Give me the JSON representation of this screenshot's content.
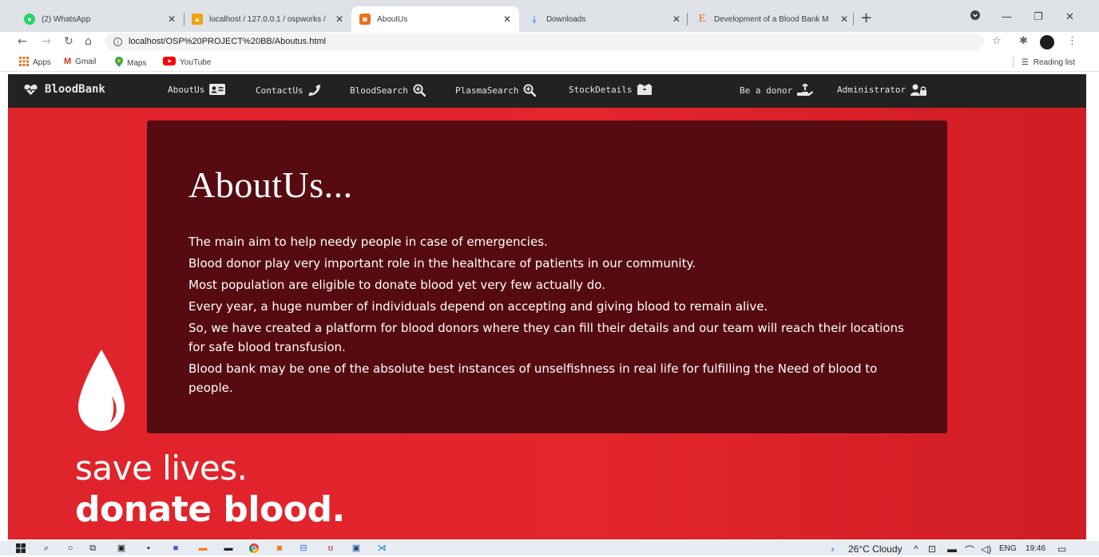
{
  "browser": {
    "tabs": [
      {
        "title": "(2) WhatsApp",
        "active": false,
        "favicon": "whatsapp-icon",
        "color": "#25d366"
      },
      {
        "title": "localhost / 127.0.0.1 / ospworks /",
        "active": false,
        "favicon": "phpmyadmin-icon",
        "color": "#f0a30a"
      },
      {
        "title": "AboutUs",
        "active": true,
        "favicon": "page-icon",
        "color": "#e8711c"
      },
      {
        "title": "Downloads",
        "active": false,
        "favicon": "download-icon",
        "color": "#1a73e8"
      },
      {
        "title": "Development of a Blood Bank M",
        "active": false,
        "favicon": "e-icon",
        "color": "#e8711c"
      }
    ],
    "url": "localhost/OSP%20PROJECT%20BB/Aboutus.html",
    "bookmarks": [
      "Apps",
      "Gmail",
      "Maps",
      "YouTube"
    ],
    "reading_list": "Reading list"
  },
  "site": {
    "brand": "BloodBank",
    "nav": [
      "AboutUs",
      "ContactUs",
      "BloodSearch",
      "PlasmaSearch",
      "StockDetails",
      "Be a donor",
      "Administrator"
    ]
  },
  "about": {
    "title": "AboutUs...",
    "paragraphs": [
      "The main aim to help needy people in case of emergencies.",
      "Blood donor play very important role in the healthcare of patients in our community.",
      "Most population are eligible to donate blood yet very few actually do.",
      "Every year, a huge number of individuals depend on accepting and giving blood to remain alive.",
      "So, we have created a platform for blood donors where they can fill their details and our team will reach their locations for safe blood transfusion.",
      "Blood bank may be one of the absolute best instances of unselfishness in real life for fulfilling the Need of blood to people."
    ]
  },
  "banner": {
    "line1": "save lives.",
    "line2": "donate blood."
  },
  "taskbar": {
    "weather": "26°C Cloudy",
    "lang": "ENG",
    "time": "19:46"
  },
  "colors": {
    "page_red": "#e0242b",
    "about_box": "#560b11",
    "nav_bg": "#222222"
  }
}
